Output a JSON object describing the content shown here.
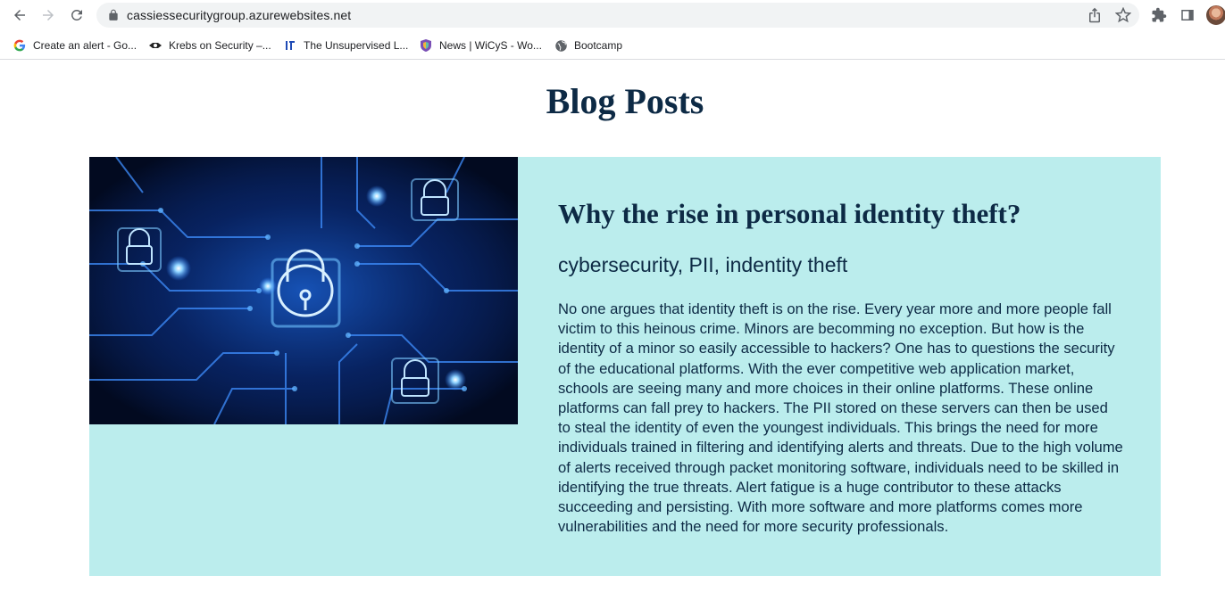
{
  "browser": {
    "url": "cassiessecuritygroup.azurewebsites.net",
    "bookmarks": [
      {
        "label": "Create an alert - Go...",
        "icon": "google-icon"
      },
      {
        "label": "Krebs on Security –...",
        "icon": "krebs-icon"
      },
      {
        "label": "The Unsupervised L...",
        "icon": "unsupervised-learning-icon"
      },
      {
        "label": "News | WiCyS - Wo...",
        "icon": "wicys-shield-icon"
      },
      {
        "label": "Bootcamp",
        "icon": "globe-icon"
      }
    ]
  },
  "page": {
    "title": "Blog Posts"
  },
  "post": {
    "image_icon": "circuit-padlock-image",
    "title": "Why the rise in personal identity theft?",
    "tags": "cybersecurity, PII, indentity theft",
    "body": "No one argues that identity theft is on the rise. Every year more and more people fall victim to this heinous crime. Minors are becomming no exception. But how is the identity of a minor so easily accessible to hackers? One has to questions the security of the educational platforms. With the ever competitive web application market, schools are seeing many and more choices in their online platforms. These online platforms can fall prey to hackers. The PII stored on these servers can then be used to steal the identity of even the youngest individuals. This brings the need for more individuals trained in filtering and identifying alerts and threats. Due to the high volume of alerts received through packet monitoring software, individuals need to be skilled in identifying the true threats. Alert fatigue is a huge contributor to these attacks succeeding and persisting. With more software and more platforms comes more vulnerabilities and the need for more security professionals."
  },
  "colors": {
    "heading": "#0d2a45",
    "card_background": "#bbeded"
  }
}
